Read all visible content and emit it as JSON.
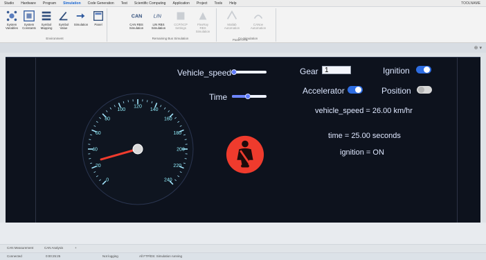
{
  "header": {
    "menus": [
      "Studio",
      "Hardware",
      "Program",
      "Simulation",
      "Code Generation",
      "Test",
      "Scientific Computing",
      "Application",
      "Project",
      "Tools",
      "Help"
    ],
    "active_menu": "Simulation",
    "right_text": "TOOLNAME"
  },
  "ribbon": {
    "groups": [
      {
        "label": "Environment",
        "buttons": [
          {
            "label": "System Variables",
            "icon": "system-variables-icon"
          },
          {
            "label": "System Constants",
            "icon": "system-constants-icon"
          },
          {
            "label": "Symbol Mapping",
            "icon": "symbol-mapping-icon"
          },
          {
            "label": "Symbol Value",
            "icon": "symbol-value-icon"
          },
          {
            "label": "Simulation",
            "icon": "simulation-icon"
          },
          {
            "label": "Panel",
            "icon": "panel-icon"
          }
        ]
      },
      {
        "label": "Remaining Bus Simulation",
        "buttons": [
          {
            "label": "CAN RBS Simulation",
            "icon": "can-rbs-icon"
          },
          {
            "label": "LIN RBS Simulation",
            "icon": "lin-rbs-icon"
          },
          {
            "label": "CCP/XCP Settings",
            "icon": "ccp-xcp-settings-icon"
          },
          {
            "label": "FlexRay RBS Simulation",
            "icon": "flexray-rbs-icon"
          }
        ]
      },
      {
        "label": "Co-Simulation",
        "buttons": [
          {
            "label": "Matlab Automation",
            "icon": "matlab-automation-icon"
          },
          {
            "label": "CANoe Automation",
            "icon": "canoe-automation-icon"
          }
        ]
      }
    ],
    "bottom_label": "Panel HTB"
  },
  "toolbar_strip": {
    "right_text": "⊕ ▾"
  },
  "dashboard": {
    "vehicle_speed_label": "Vehicle_speed",
    "time_label": "Time",
    "gear_label": "Gear",
    "gear_value": "1",
    "ignition_label": "Ignition",
    "accelerator_label": "Accelerator",
    "position_label": "Position",
    "speed_readout": "vehicle_speed = 26.00 km/hr",
    "time_readout": "time = 25.00 seconds",
    "ignition_readout": "ignition = ON",
    "speedometer_title": "vehicle_speed",
    "speedometer": {
      "value": 26,
      "min": 0,
      "max": 240,
      "start_angle": 225,
      "end_angle": -45,
      "major_ticks": [
        0,
        20,
        40,
        60,
        80,
        100,
        120,
        140,
        160,
        180,
        200,
        220,
        240
      ],
      "tick_labels": [
        "0",
        "20",
        "40",
        "60",
        "80",
        "100",
        "120",
        "140",
        "160",
        "180",
        "200",
        "220",
        "240"
      ]
    },
    "vehicle_speed_slider": 0.05,
    "time_slider": 0.45,
    "toggles": {
      "ignition": true,
      "accelerator": true,
      "position": false
    },
    "colors": {
      "background": "#0d121d",
      "accent": "#2e6de1",
      "gauge_text": "#94f1ff",
      "seatbelt": "#ef3b2d"
    }
  },
  "status": {
    "tab_one": "CAN Measurement",
    "tab_two": "CAN Analysis",
    "tab_three": "+",
    "left_state": "Connected",
    "middle_state": "0:00:25:25",
    "logging_state": "Not logging",
    "right_state": "All FTP/DS: Simulation running"
  }
}
